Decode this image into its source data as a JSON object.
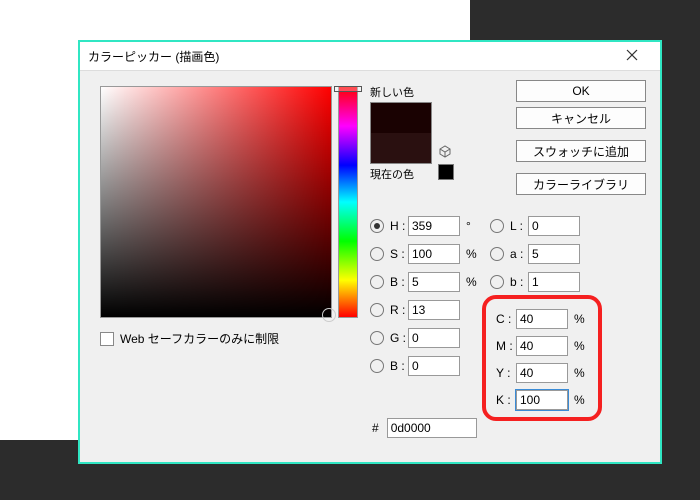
{
  "dialog_title": "カラーピッカー (描画色)",
  "buttons": {
    "ok": "OK",
    "cancel": "キャンセル",
    "add_swatch": "スウォッチに追加",
    "color_library": "カラーライブラリ"
  },
  "swatch": {
    "new_label": "新しい色",
    "current_label": "現在の色",
    "new_color": "#1a0202",
    "current_color": "#2a1010"
  },
  "websafe_label": "Web セーフカラーのみに制限",
  "hsb": {
    "h": {
      "label": "H :",
      "value": "359",
      "unit": "°",
      "checked": true
    },
    "s": {
      "label": "S :",
      "value": "100",
      "unit": "%",
      "checked": false
    },
    "b": {
      "label": "B :",
      "value": "5",
      "unit": "%",
      "checked": false
    }
  },
  "rgb": {
    "r": {
      "label": "R :",
      "value": "13",
      "checked": false
    },
    "g": {
      "label": "G :",
      "value": "0",
      "checked": false
    },
    "b": {
      "label": "B :",
      "value": "0",
      "checked": false
    }
  },
  "lab": {
    "l": {
      "label": "L :",
      "value": "0",
      "checked": false
    },
    "a": {
      "label": "a :",
      "value": "5",
      "checked": false
    },
    "b": {
      "label": "b :",
      "value": "1",
      "checked": false
    }
  },
  "cmyk": {
    "c": {
      "label": "C :",
      "value": "40",
      "unit": "%"
    },
    "m": {
      "label": "M :",
      "value": "40",
      "unit": "%"
    },
    "y": {
      "label": "Y :",
      "value": "40",
      "unit": "%"
    },
    "k": {
      "label": "K :",
      "value": "100",
      "unit": "%"
    }
  },
  "hex": {
    "label": "#",
    "value": "0d0000"
  }
}
